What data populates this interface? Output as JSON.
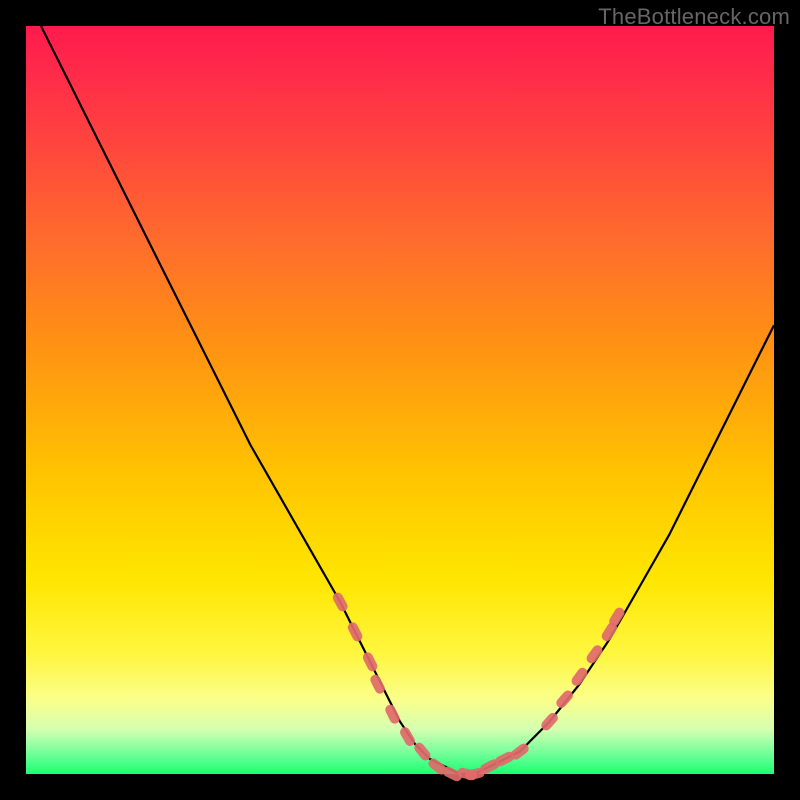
{
  "watermark": "TheBottleneck.com",
  "colors": {
    "curve_stroke": "#000000",
    "marker_fill": "#e06a6a",
    "marker_stroke": "#e06a6a",
    "background_black": "#000000"
  },
  "chart_data": {
    "type": "line",
    "title": "",
    "xlabel": "",
    "ylabel": "",
    "xlim": [
      0,
      100
    ],
    "ylim": [
      0,
      100
    ],
    "grid": false,
    "series": [
      {
        "name": "bottleneck_curve",
        "x": [
          2,
          6,
          10,
          14,
          18,
          22,
          26,
          30,
          34,
          38,
          42,
          44,
          46,
          48,
          50,
          52,
          54,
          56,
          58,
          60,
          62,
          66,
          70,
          74,
          78,
          82,
          86,
          90,
          94,
          98,
          100
        ],
        "y": [
          100,
          92,
          84,
          76,
          68,
          60,
          52,
          44,
          37,
          30,
          23,
          19,
          15,
          11,
          7,
          4,
          2,
          1,
          0,
          0,
          1,
          3,
          7,
          12,
          18,
          25,
          32,
          40,
          48,
          56,
          60
        ]
      }
    ],
    "markers": [
      {
        "x": 42,
        "y": 23
      },
      {
        "x": 44,
        "y": 19
      },
      {
        "x": 46,
        "y": 15
      },
      {
        "x": 47,
        "y": 12
      },
      {
        "x": 49,
        "y": 8
      },
      {
        "x": 51,
        "y": 5
      },
      {
        "x": 53,
        "y": 3
      },
      {
        "x": 55,
        "y": 1
      },
      {
        "x": 57,
        "y": 0
      },
      {
        "x": 59,
        "y": 0
      },
      {
        "x": 60,
        "y": 0
      },
      {
        "x": 62,
        "y": 1
      },
      {
        "x": 64,
        "y": 2
      },
      {
        "x": 66,
        "y": 3
      },
      {
        "x": 70,
        "y": 7
      },
      {
        "x": 72,
        "y": 10
      },
      {
        "x": 74,
        "y": 13
      },
      {
        "x": 76,
        "y": 16
      },
      {
        "x": 78,
        "y": 19
      },
      {
        "x": 79,
        "y": 21
      }
    ]
  }
}
